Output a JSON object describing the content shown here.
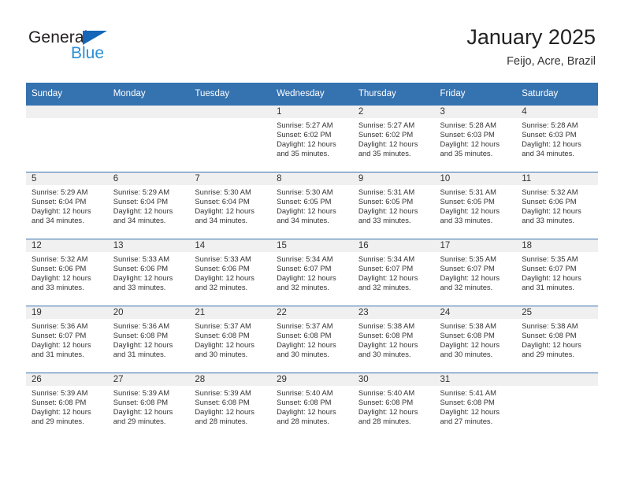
{
  "brand": {
    "name_part1": "General",
    "name_part2": "Blue",
    "triangle_color": "#1565b8",
    "blue_color": "#2a8fd8"
  },
  "header": {
    "month_title": "January 2025",
    "location": "Feijo, Acre, Brazil"
  },
  "theme": {
    "header_bg": "#3572b0",
    "header_text": "#ffffff",
    "daynum_bar_bg": "#f0f0f0",
    "body_text": "#333333"
  },
  "weekday_headers": [
    "Sunday",
    "Monday",
    "Tuesday",
    "Wednesday",
    "Thursday",
    "Friday",
    "Saturday"
  ],
  "weeks": [
    [
      {
        "day": "",
        "lines": []
      },
      {
        "day": "",
        "lines": []
      },
      {
        "day": "",
        "lines": []
      },
      {
        "day": "1",
        "lines": [
          "Sunrise: 5:27 AM",
          "Sunset: 6:02 PM",
          "Daylight: 12 hours",
          "and 35 minutes."
        ]
      },
      {
        "day": "2",
        "lines": [
          "Sunrise: 5:27 AM",
          "Sunset: 6:02 PM",
          "Daylight: 12 hours",
          "and 35 minutes."
        ]
      },
      {
        "day": "3",
        "lines": [
          "Sunrise: 5:28 AM",
          "Sunset: 6:03 PM",
          "Daylight: 12 hours",
          "and 35 minutes."
        ]
      },
      {
        "day": "4",
        "lines": [
          "Sunrise: 5:28 AM",
          "Sunset: 6:03 PM",
          "Daylight: 12 hours",
          "and 34 minutes."
        ]
      }
    ],
    [
      {
        "day": "5",
        "lines": [
          "Sunrise: 5:29 AM",
          "Sunset: 6:04 PM",
          "Daylight: 12 hours",
          "and 34 minutes."
        ]
      },
      {
        "day": "6",
        "lines": [
          "Sunrise: 5:29 AM",
          "Sunset: 6:04 PM",
          "Daylight: 12 hours",
          "and 34 minutes."
        ]
      },
      {
        "day": "7",
        "lines": [
          "Sunrise: 5:30 AM",
          "Sunset: 6:04 PM",
          "Daylight: 12 hours",
          "and 34 minutes."
        ]
      },
      {
        "day": "8",
        "lines": [
          "Sunrise: 5:30 AM",
          "Sunset: 6:05 PM",
          "Daylight: 12 hours",
          "and 34 minutes."
        ]
      },
      {
        "day": "9",
        "lines": [
          "Sunrise: 5:31 AM",
          "Sunset: 6:05 PM",
          "Daylight: 12 hours",
          "and 33 minutes."
        ]
      },
      {
        "day": "10",
        "lines": [
          "Sunrise: 5:31 AM",
          "Sunset: 6:05 PM",
          "Daylight: 12 hours",
          "and 33 minutes."
        ]
      },
      {
        "day": "11",
        "lines": [
          "Sunrise: 5:32 AM",
          "Sunset: 6:06 PM",
          "Daylight: 12 hours",
          "and 33 minutes."
        ]
      }
    ],
    [
      {
        "day": "12",
        "lines": [
          "Sunrise: 5:32 AM",
          "Sunset: 6:06 PM",
          "Daylight: 12 hours",
          "and 33 minutes."
        ]
      },
      {
        "day": "13",
        "lines": [
          "Sunrise: 5:33 AM",
          "Sunset: 6:06 PM",
          "Daylight: 12 hours",
          "and 33 minutes."
        ]
      },
      {
        "day": "14",
        "lines": [
          "Sunrise: 5:33 AM",
          "Sunset: 6:06 PM",
          "Daylight: 12 hours",
          "and 32 minutes."
        ]
      },
      {
        "day": "15",
        "lines": [
          "Sunrise: 5:34 AM",
          "Sunset: 6:07 PM",
          "Daylight: 12 hours",
          "and 32 minutes."
        ]
      },
      {
        "day": "16",
        "lines": [
          "Sunrise: 5:34 AM",
          "Sunset: 6:07 PM",
          "Daylight: 12 hours",
          "and 32 minutes."
        ]
      },
      {
        "day": "17",
        "lines": [
          "Sunrise: 5:35 AM",
          "Sunset: 6:07 PM",
          "Daylight: 12 hours",
          "and 32 minutes."
        ]
      },
      {
        "day": "18",
        "lines": [
          "Sunrise: 5:35 AM",
          "Sunset: 6:07 PM",
          "Daylight: 12 hours",
          "and 31 minutes."
        ]
      }
    ],
    [
      {
        "day": "19",
        "lines": [
          "Sunrise: 5:36 AM",
          "Sunset: 6:07 PM",
          "Daylight: 12 hours",
          "and 31 minutes."
        ]
      },
      {
        "day": "20",
        "lines": [
          "Sunrise: 5:36 AM",
          "Sunset: 6:08 PM",
          "Daylight: 12 hours",
          "and 31 minutes."
        ]
      },
      {
        "day": "21",
        "lines": [
          "Sunrise: 5:37 AM",
          "Sunset: 6:08 PM",
          "Daylight: 12 hours",
          "and 30 minutes."
        ]
      },
      {
        "day": "22",
        "lines": [
          "Sunrise: 5:37 AM",
          "Sunset: 6:08 PM",
          "Daylight: 12 hours",
          "and 30 minutes."
        ]
      },
      {
        "day": "23",
        "lines": [
          "Sunrise: 5:38 AM",
          "Sunset: 6:08 PM",
          "Daylight: 12 hours",
          "and 30 minutes."
        ]
      },
      {
        "day": "24",
        "lines": [
          "Sunrise: 5:38 AM",
          "Sunset: 6:08 PM",
          "Daylight: 12 hours",
          "and 30 minutes."
        ]
      },
      {
        "day": "25",
        "lines": [
          "Sunrise: 5:38 AM",
          "Sunset: 6:08 PM",
          "Daylight: 12 hours",
          "and 29 minutes."
        ]
      }
    ],
    [
      {
        "day": "26",
        "lines": [
          "Sunrise: 5:39 AM",
          "Sunset: 6:08 PM",
          "Daylight: 12 hours",
          "and 29 minutes."
        ]
      },
      {
        "day": "27",
        "lines": [
          "Sunrise: 5:39 AM",
          "Sunset: 6:08 PM",
          "Daylight: 12 hours",
          "and 29 minutes."
        ]
      },
      {
        "day": "28",
        "lines": [
          "Sunrise: 5:39 AM",
          "Sunset: 6:08 PM",
          "Daylight: 12 hours",
          "and 28 minutes."
        ]
      },
      {
        "day": "29",
        "lines": [
          "Sunrise: 5:40 AM",
          "Sunset: 6:08 PM",
          "Daylight: 12 hours",
          "and 28 minutes."
        ]
      },
      {
        "day": "30",
        "lines": [
          "Sunrise: 5:40 AM",
          "Sunset: 6:08 PM",
          "Daylight: 12 hours",
          "and 28 minutes."
        ]
      },
      {
        "day": "31",
        "lines": [
          "Sunrise: 5:41 AM",
          "Sunset: 6:08 PM",
          "Daylight: 12 hours",
          "and 27 minutes."
        ]
      },
      {
        "day": "",
        "lines": []
      }
    ]
  ]
}
